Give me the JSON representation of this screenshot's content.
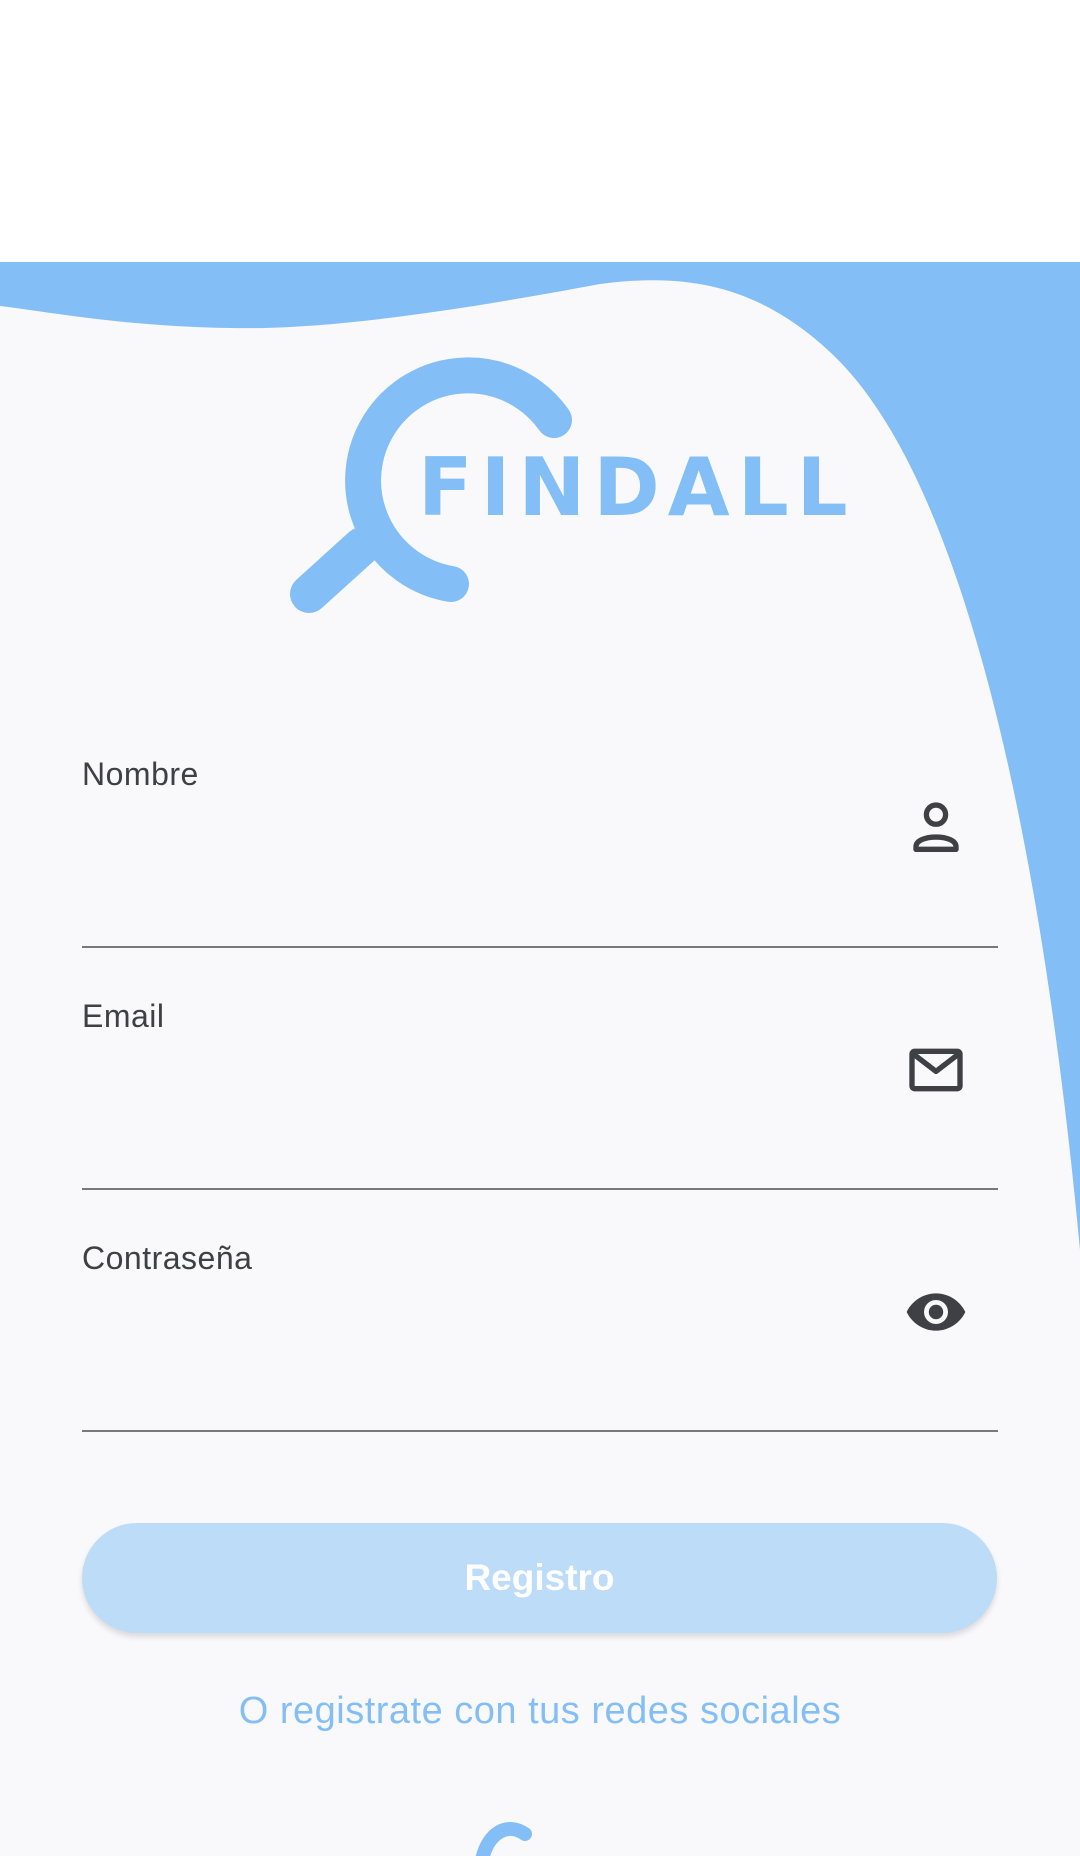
{
  "brand": {
    "name": "FINDALL",
    "accent_color": "#83bff6",
    "logo_icon": "magnifying-glass-icon"
  },
  "form": {
    "name_field": {
      "label": "Nombre",
      "value": "",
      "icon": "person-icon"
    },
    "email_field": {
      "label": "Email",
      "value": "",
      "icon": "mail-icon"
    },
    "password_field": {
      "label": "Contraseña",
      "value": "",
      "icon": "eye-icon"
    },
    "submit_label": "Registro"
  },
  "social": {
    "prompt": "O registrate con tus redes sociales"
  }
}
